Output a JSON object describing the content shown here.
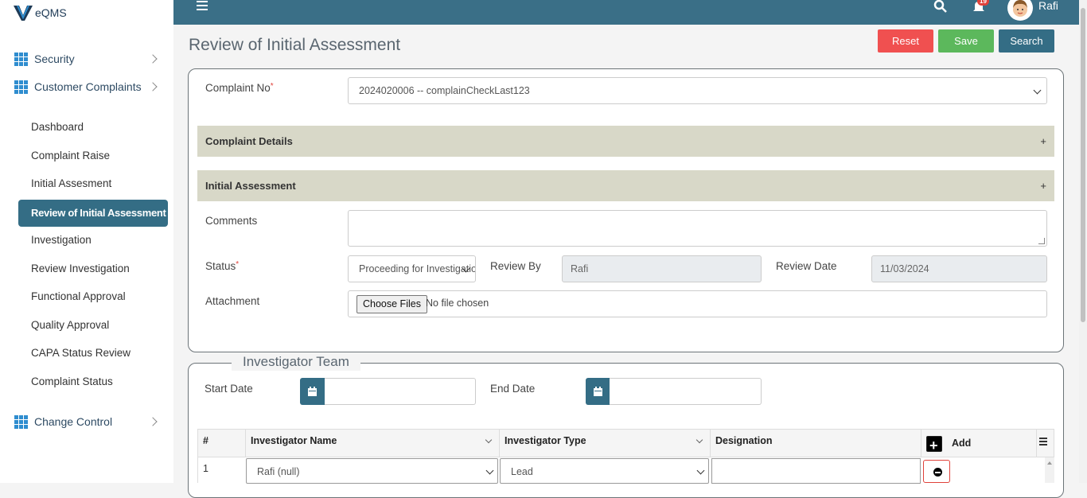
{
  "app": {
    "name": "eQMS",
    "user": "Rafi",
    "notification_count": "19"
  },
  "sidebar": {
    "groups": [
      {
        "label": "Security"
      },
      {
        "label": "Customer Complaints"
      },
      {
        "label": "Change Control"
      }
    ],
    "items": [
      {
        "label": "Dashboard"
      },
      {
        "label": "Complaint Raise"
      },
      {
        "label": "Initial Assesment"
      },
      {
        "label": "Review of Initial Assessment"
      },
      {
        "label": "Investigation"
      },
      {
        "label": "Review Investigation"
      },
      {
        "label": "Functional Approval"
      },
      {
        "label": "Quality Approval"
      },
      {
        "label": "CAPA Status Review"
      },
      {
        "label": "Complaint Status"
      }
    ]
  },
  "page": {
    "title": "Review of Initial Assessment",
    "buttons": {
      "reset": "Reset",
      "save": "Save",
      "search": "Search"
    }
  },
  "form": {
    "complaint_no_label": "Complaint No",
    "complaint_no_value": "2024020006 -- complainCheckLast123",
    "complaint_details_label": "Complaint Details",
    "initial_assessment_label": "Initial Assessment",
    "expand_symbol": "+",
    "comments_label": "Comments",
    "status_label": "Status",
    "status_value": "Proceeding for Investigation",
    "review_by_label": "Review By",
    "review_by_value": "Rafi",
    "review_date_label": "Review Date",
    "review_date_value": "11/03/2024",
    "attachment_label": "Attachment",
    "choose_files": "Choose Files",
    "no_file": "No file chosen",
    "required_mark": "*"
  },
  "team": {
    "legend": "Investigator Team",
    "start_date_label": "Start Date",
    "end_date_label": "End Date",
    "columns": [
      "#",
      "Investigator Name",
      "Investigator Type",
      "Designation",
      "Add"
    ],
    "rows": [
      {
        "num": "1",
        "name": "Rafi (null)",
        "type": "Lead",
        "designation": ""
      }
    ]
  }
}
